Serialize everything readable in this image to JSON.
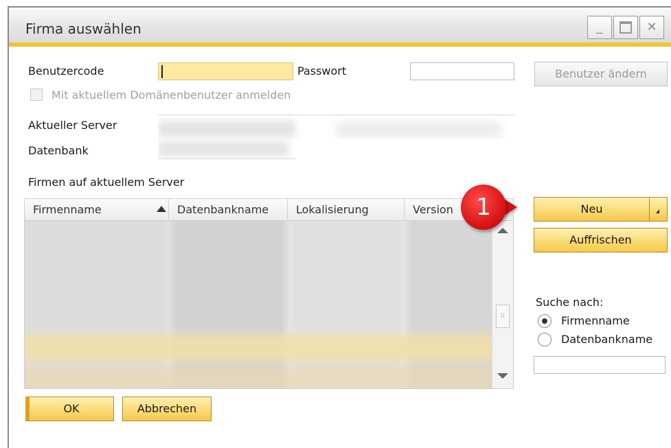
{
  "window": {
    "title": "Firma auswählen",
    "controls": [
      "minimize",
      "maximize",
      "close"
    ],
    "close_glyph": "✕",
    "minimize_glyph": "_"
  },
  "login": {
    "user_code_label": "Benutzercode",
    "user_code_value": "",
    "password_label": "Passwort",
    "password_value": "",
    "change_user_button": "Benutzer ändern",
    "domain_user_checkbox_label": "Mit aktuellem Domänenbenutzer anmelden",
    "domain_user_checked": false
  },
  "server": {
    "current_server_label": "Aktueller Server",
    "database_label": "Datenbank"
  },
  "companies": {
    "section_label": "Firmen auf aktuellem Server",
    "columns": [
      "Firmenname",
      "Datenbankname",
      "Lokalisierung",
      "Version"
    ],
    "sorted_column": "Firmenname"
  },
  "actions": {
    "new_button": "Neu",
    "refresh_button": "Auffrischen",
    "ok_button": "OK",
    "cancel_button": "Abbrechen"
  },
  "search": {
    "label": "Suche nach:",
    "options": [
      "Firmenname",
      "Datenbankname"
    ],
    "selected": "Firmenname",
    "value": ""
  },
  "annotation": {
    "badge_number": "1",
    "color": "#d40f0f"
  },
  "colors": {
    "accent": "#f2c232",
    "input_highlight": "#fde9a0"
  }
}
